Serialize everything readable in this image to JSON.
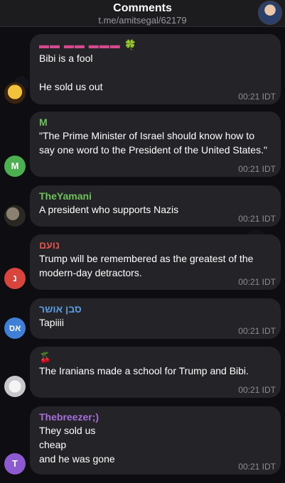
{
  "header": {
    "title": "Comments",
    "subtitle": "t.me/amitsegal/62179",
    "avatar_icon": "user-photo"
  },
  "messages": [
    {
      "sender": "",
      "sender_emoji": "▬▬ ▬▬ ▬▬▬",
      "clover": "🍀",
      "sender_color": "#d44a8f",
      "text": "Bibi is a fool\n\nHe sold us out",
      "time": "00:21 IDT",
      "avatar": ""
    },
    {
      "sender": "M",
      "sender_color": "#6fc25a",
      "text": "\"The Prime Minister of Israel should know how to say one word to the President of the United States.\"",
      "time": "00:21 IDT",
      "avatar": "M",
      "avatar_color": "#4caf50"
    },
    {
      "sender": "TheYamani",
      "sender_color": "#6fc25a",
      "text": "A president who supports Nazis",
      "time": "00:21 IDT",
      "avatar": ""
    },
    {
      "sender": "נועם",
      "sender_color": "#e0524a",
      "text": "Trump will be remembered as the greatest of the modern-day detractors.",
      "time": "00:21 IDT",
      "avatar": "נ",
      "avatar_color": "#d9453c"
    },
    {
      "sender": "סבן אושר",
      "sender_color": "#5b9be0",
      "text": "Tapiiii",
      "time": "00:21 IDT",
      "avatar": "אס",
      "avatar_color": "#3f7fd6"
    },
    {
      "sender": "🍒",
      "sender_color": "#e0524a",
      "text": "The Iranians made a school for Trump and Bibi.",
      "time": "00:21 IDT",
      "avatar": ""
    },
    {
      "sender": "Thebreezer;)",
      "sender_color": "#a66ed8",
      "text": "They sold us\ncheap\nand he was gone",
      "time": "00:21 IDT",
      "avatar": "T",
      "avatar_color": "#8e5ad0"
    }
  ]
}
